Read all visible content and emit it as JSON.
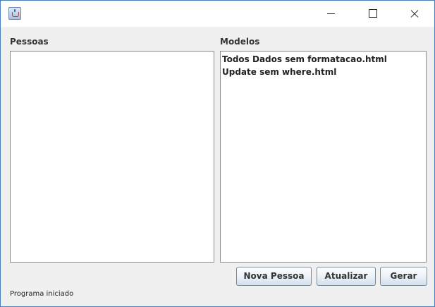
{
  "window": {
    "title": "",
    "icon": "java-coffee-cup-icon",
    "controls": [
      "minimize-icon",
      "maximize-icon",
      "close-icon"
    ]
  },
  "pessoas": {
    "label": "Pessoas",
    "items": []
  },
  "modelos": {
    "label": "Modelos",
    "items": [
      "Todos Dados sem formatacao.html",
      "Update sem where.html"
    ]
  },
  "buttons": {
    "nova_pessoa": "Nova Pessoa",
    "atualizar": "Atualizar",
    "gerar": "Gerar"
  },
  "status": "Programa iniciado",
  "colors": {
    "window_border": "#4a7fc0",
    "panel_background": "#f0f0f0",
    "list_background": "#ffffff"
  }
}
